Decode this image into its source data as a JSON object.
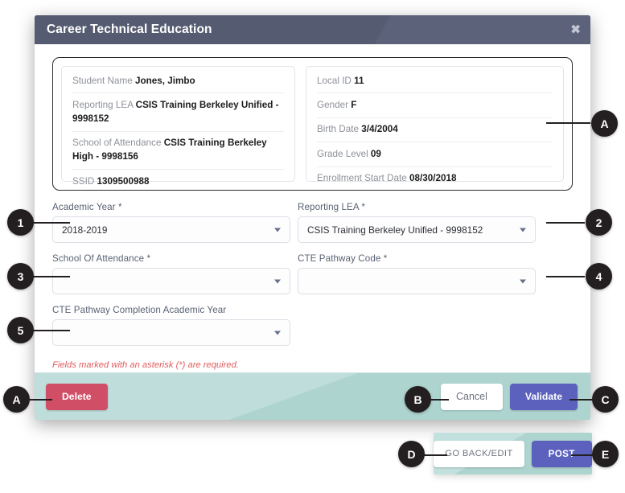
{
  "window": {
    "title": "Career Technical Education",
    "close_icon": "close-icon",
    "close_glyph": "✖"
  },
  "student_info": {
    "left_panel": [
      {
        "label": "Student Name",
        "value": "Jones, Jimbo"
      },
      {
        "label": "Reporting LEA",
        "value": "CSIS Training Berkeley Unified - 9998152"
      },
      {
        "label": "School of Attendance",
        "value": "CSIS Training Berkeley High - 9998156"
      },
      {
        "label": "SSID",
        "value": "1309500988"
      }
    ],
    "right_panel": [
      {
        "label": "Local ID",
        "value": "11"
      },
      {
        "label": "Gender",
        "value": "F"
      },
      {
        "label": "Birth Date",
        "value": "3/4/2004"
      },
      {
        "label": "Grade Level",
        "value": "09"
      },
      {
        "label": "Enrollment Start Date",
        "value": "08/30/2018"
      }
    ]
  },
  "form": {
    "fields": [
      {
        "label": "Academic Year *",
        "value": "2018-2019",
        "placeholder": ""
      },
      {
        "label": "Reporting LEA *",
        "value": "CSIS Training Berkeley Unified - 9998152",
        "placeholder": ""
      },
      {
        "label": "School Of Attendance *",
        "value": "",
        "placeholder": ""
      },
      {
        "label": "CTE Pathway Code *",
        "value": "",
        "placeholder": ""
      },
      {
        "label": "CTE Pathway Completion Academic Year",
        "value": "",
        "placeholder": ""
      }
    ],
    "required_note": "Fields marked with an asterisk (*) are required."
  },
  "footer": {
    "delete_label": "Delete",
    "cancel_label": "Cancel",
    "validate_label": "Validate"
  },
  "bottom_bar": {
    "go_back_label": "GO BACK/EDIT",
    "post_label": "POST"
  },
  "callouts": {
    "c1": "1",
    "c2": "2",
    "c3": "3",
    "c4": "4",
    "c5": "5",
    "cA_top": "A",
    "cA_bottom": "A",
    "cB": "B",
    "cC": "C",
    "cD": "D",
    "cE": "E"
  },
  "colors": {
    "header_bg": "#565d72",
    "footer_bg": "#b5d9d4",
    "delete_red": "#d04f66",
    "primary_purple": "#5b61bd",
    "required_red": "#e05d5d",
    "callout_black": "#231f20"
  }
}
